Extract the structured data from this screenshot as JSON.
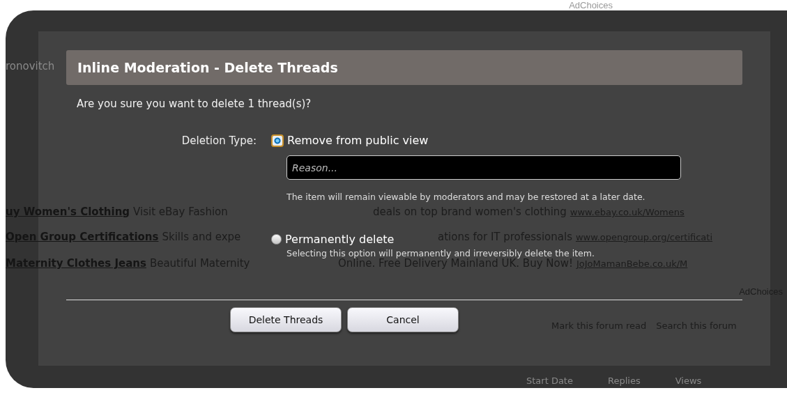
{
  "page": {
    "top_link": "AdChoices",
    "user_name": "ronovitch",
    "ads": [
      {
        "title": "uy Women's Clothing",
        "text_left": "Visit eBay Fashion",
        "text_right": "deals on top brand women's clothing",
        "url": "www.ebay.co.uk/Womens"
      },
      {
        "title": "Open Group Certifications",
        "text_left": "Skills and expe",
        "text_right": "ations for IT professionals",
        "url": "www.opengroup.org/certificati"
      },
      {
        "title": "Maternity Clothes Jeans",
        "text_left": "Beautiful Maternity",
        "text_right": "Online. Free Delivery Mainland UK. Buy Now!",
        "url": "JoJoMamanBebe.co.uk/M"
      }
    ],
    "ad_choices": "AdChoices",
    "links": [
      "Mark this forum read",
      "Search this forum"
    ],
    "columns": [
      "Start Date",
      "Replies",
      "Views"
    ]
  },
  "dialog": {
    "title": "Inline Moderation - Delete Threads",
    "question": "Are you sure you want to delete 1 thread(s)?",
    "deletion_label": "Deletion Type:",
    "options": [
      {
        "label": "Remove from public view",
        "selected": true,
        "reason": {
          "placeholder": "Reason..."
        },
        "description": "The item will remain viewable by moderators and may be restored at a later date."
      },
      {
        "label": "Permanently delete",
        "selected": false,
        "description": "Selecting this option will permanently and irreversibly delete the item."
      }
    ],
    "buttons": [
      "Delete Threads",
      "Cancel"
    ]
  }
}
